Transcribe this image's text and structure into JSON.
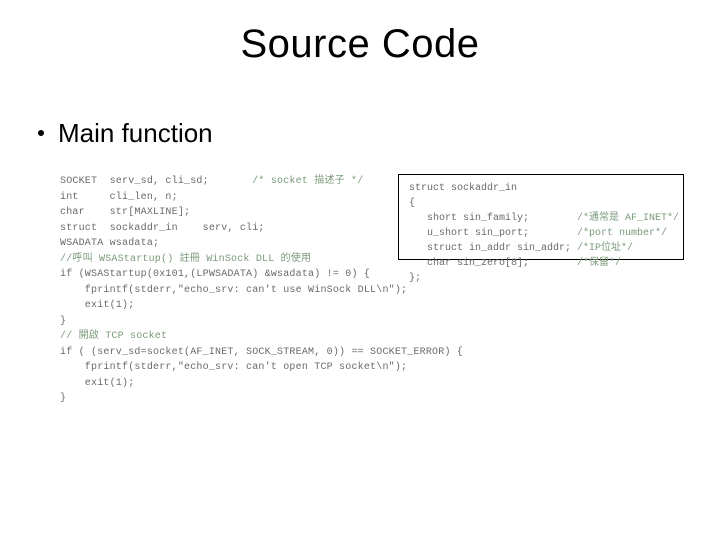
{
  "title": "Source Code",
  "bullet": "Main function",
  "code_main": [
    {
      "t": "SOCKET  serv_sd, cli_sd;       ",
      "c": "/* socket 描述子 */"
    },
    {
      "t": "int     cli_len, n;"
    },
    {
      "t": "char    str[MAXLINE];"
    },
    {
      "t": ""
    },
    {
      "t": "struct  sockaddr_in    serv, cli;"
    },
    {
      "t": ""
    },
    {
      "t": "WSADATA wsadata;"
    },
    {
      "t": ""
    },
    {
      "c2": "//呼叫 WSAStartup() 註冊 WinSock DLL 的使用"
    },
    {
      "t": ""
    },
    {
      "t": "if (WSAStartup(0x101,(LPWSADATA) &wsadata) != 0) {"
    },
    {
      "t": "    fprintf(stderr,\"echo_srv: can't use WinSock DLL\\n\");"
    },
    {
      "t": "    exit(1);"
    },
    {
      "t": "}"
    },
    {
      "t": ""
    },
    {
      "c2": "// 開啟 TCP socket"
    },
    {
      "t": "if ( (serv_sd=socket(AF_INET, SOCK_STREAM, 0)) == SOCKET_ERROR) {"
    },
    {
      "t": "    fprintf(stderr,\"echo_srv: can't open TCP socket\\n\");"
    },
    {
      "t": "    exit(1);"
    },
    {
      "t": "}"
    }
  ],
  "code_box": [
    {
      "t": "struct sockaddr_in"
    },
    {
      "t": "{"
    },
    {
      "t": "   short sin_family;        ",
      "c": "/*通常是 AF_INET*/"
    },
    {
      "t": "   u_short sin_port;        ",
      "c": "/*port number*/"
    },
    {
      "t": "   struct in_addr sin_addr; ",
      "c": "/*IP位址*/"
    },
    {
      "t": "   char sin_zero[8];        ",
      "c": "/*保留*/"
    },
    {
      "t": "};"
    }
  ]
}
